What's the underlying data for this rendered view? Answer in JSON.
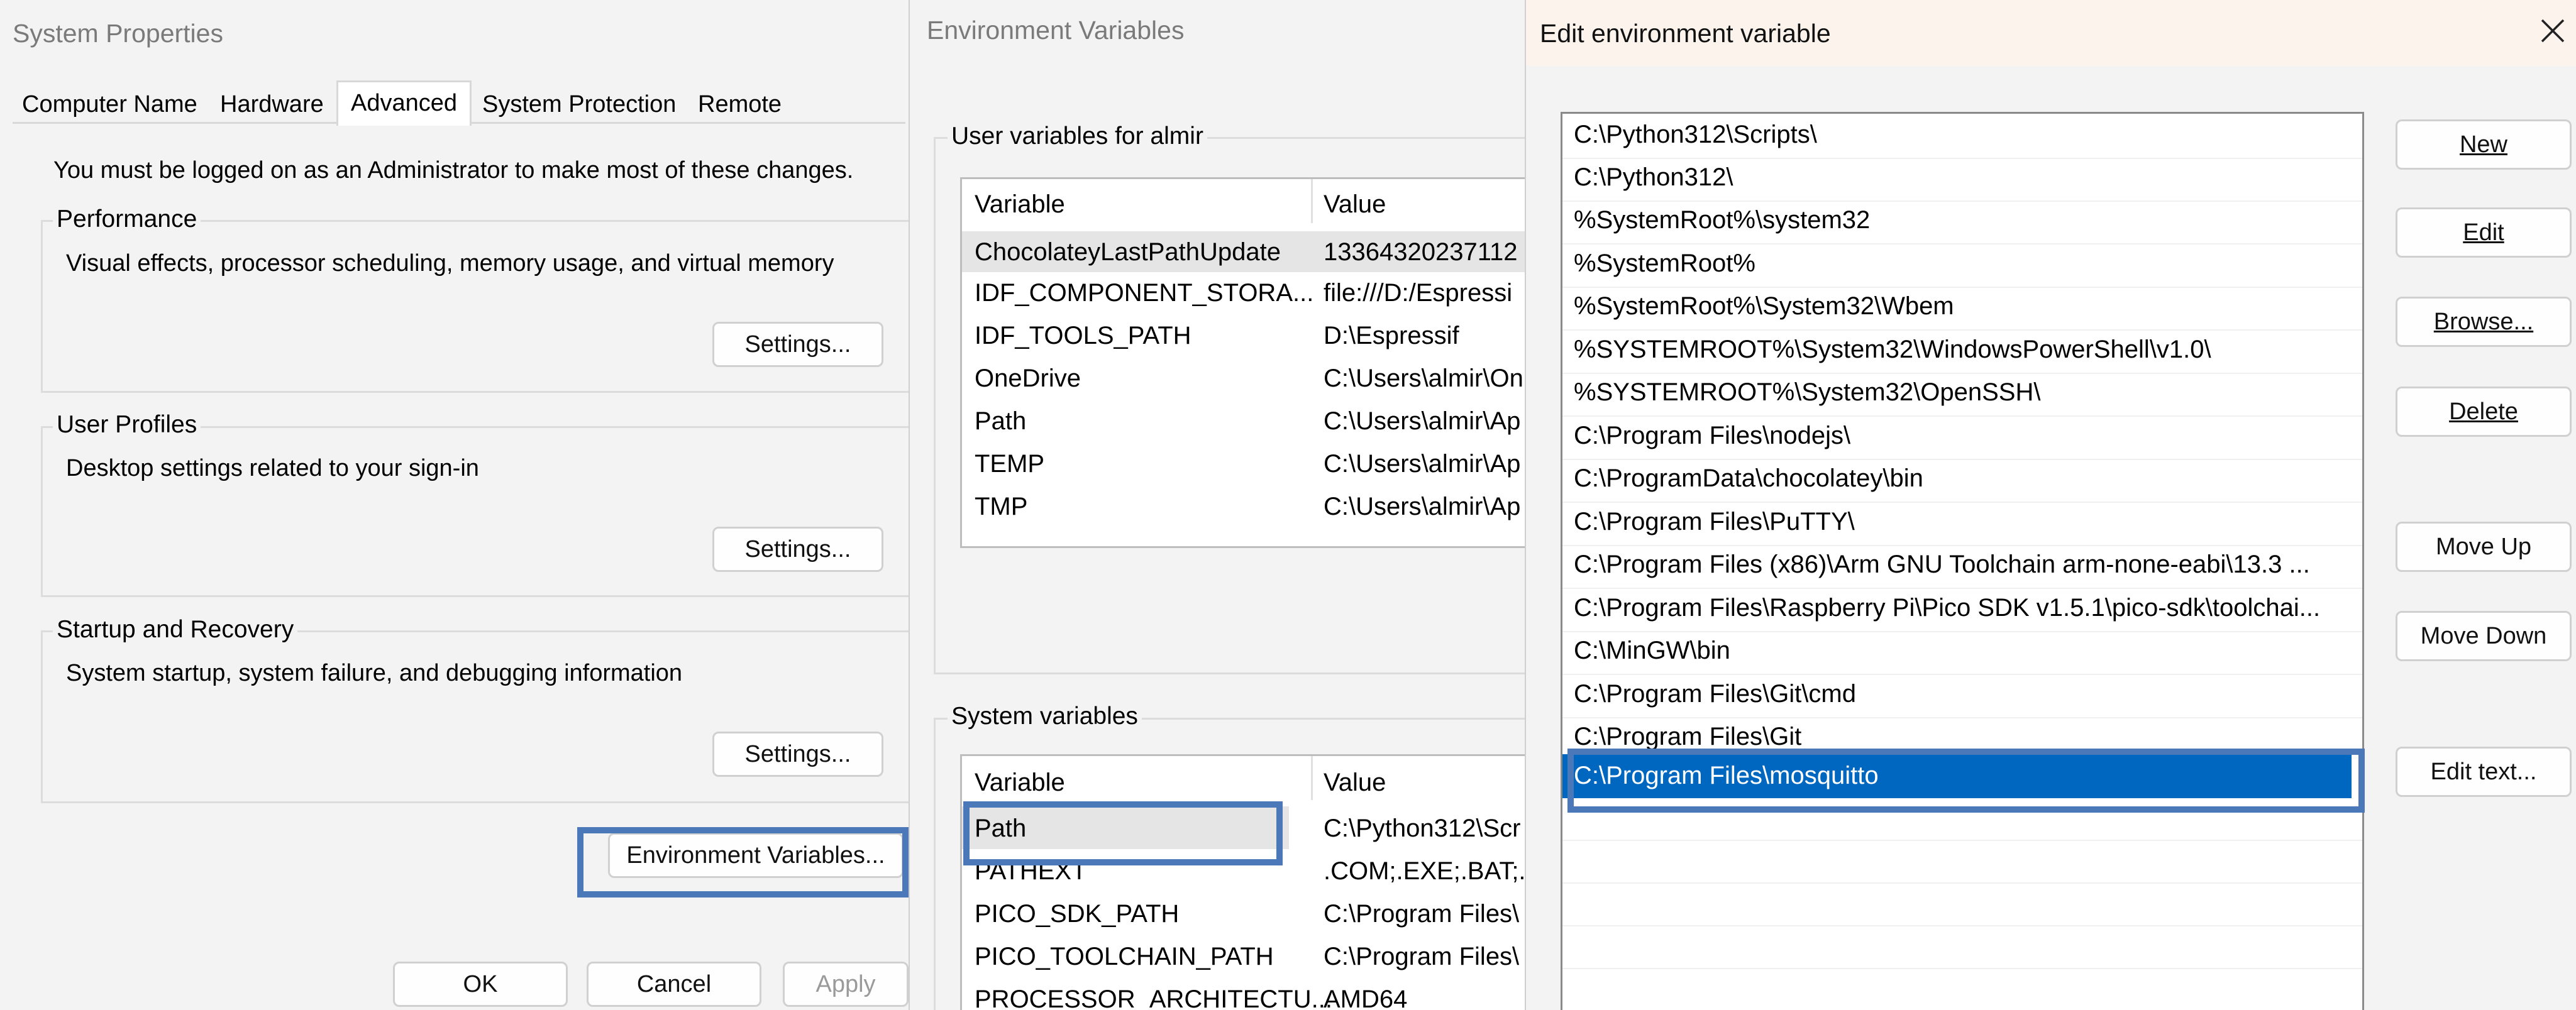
{
  "system_properties": {
    "title": "System Properties",
    "tabs": [
      "Computer Name",
      "Hardware",
      "Advanced",
      "System Protection",
      "Remote"
    ],
    "admin_note": "You must be logged on as an Administrator to make most of these changes.",
    "performance": {
      "legend": "Performance",
      "desc": "Visual effects, processor scheduling, memory usage, and virtual memory",
      "button": "Settings..."
    },
    "user_profiles": {
      "legend": "User Profiles",
      "desc": "Desktop settings related to your sign-in",
      "button": "Settings..."
    },
    "startup": {
      "legend": "Startup and Recovery",
      "desc": "System startup, system failure, and debugging information",
      "button": "Settings..."
    },
    "env_button": "Environment Variables...",
    "ok": "OK",
    "cancel": "Cancel",
    "apply": "Apply"
  },
  "env_vars": {
    "title": "Environment Variables",
    "user_legend": "User variables for almir",
    "col_variable": "Variable",
    "col_value": "Value",
    "user_rows": [
      {
        "var": "ChocolateyLastPathUpdate",
        "val": "13364320237112"
      },
      {
        "var": "IDF_COMPONENT_STORA...",
        "val": "file:///D:/Espressi"
      },
      {
        "var": "IDF_TOOLS_PATH",
        "val": "D:\\Espressif"
      },
      {
        "var": "OneDrive",
        "val": "C:\\Users\\almir\\On"
      },
      {
        "var": "Path",
        "val": "C:\\Users\\almir\\Ap"
      },
      {
        "var": "TEMP",
        "val": "C:\\Users\\almir\\Ap"
      },
      {
        "var": "TMP",
        "val": "C:\\Users\\almir\\Ap"
      }
    ],
    "system_legend": "System variables",
    "system_rows": [
      {
        "var": "Path",
        "val": "C:\\Python312\\Scr"
      },
      {
        "var": "PATHEXT",
        "val": ".COM;.EXE;.BAT;.C"
      },
      {
        "var": "PICO_SDK_PATH",
        "val": "C:\\Program Files\\"
      },
      {
        "var": "PICO_TOOLCHAIN_PATH",
        "val": "C:\\Program Files\\"
      },
      {
        "var": "PROCESSOR_ARCHITECTU...",
        "val": "AMD64"
      }
    ]
  },
  "edit_env": {
    "title": "Edit environment variable",
    "close_icon": "close-icon",
    "entries": [
      "C:\\Python312\\Scripts\\",
      "C:\\Python312\\",
      "%SystemRoot%\\system32",
      "%SystemRoot%",
      "%SystemRoot%\\System32\\Wbem",
      "%SYSTEMROOT%\\System32\\WindowsPowerShell\\v1.0\\",
      "%SYSTEMROOT%\\System32\\OpenSSH\\",
      "C:\\Program Files\\nodejs\\",
      "C:\\ProgramData\\chocolatey\\bin",
      "C:\\Program Files\\PuTTY\\",
      "C:\\Program Files (x86)\\Arm GNU Toolchain arm-none-eabi\\13.3 ...",
      "C:\\Program Files\\Raspberry Pi\\Pico SDK v1.5.1\\pico-sdk\\toolchai...",
      "C:\\MinGW\\bin",
      "C:\\Program Files\\Git\\cmd",
      "C:\\Program Files\\Git",
      "C:\\Program Files\\mosquitto"
    ],
    "buttons": {
      "new": "New",
      "edit": "Edit",
      "browse": "Browse...",
      "delete": "Delete",
      "move_up": "Move Up",
      "move_down": "Move Down",
      "edit_text": "Edit text..."
    },
    "selection_color": "#0067c0"
  }
}
